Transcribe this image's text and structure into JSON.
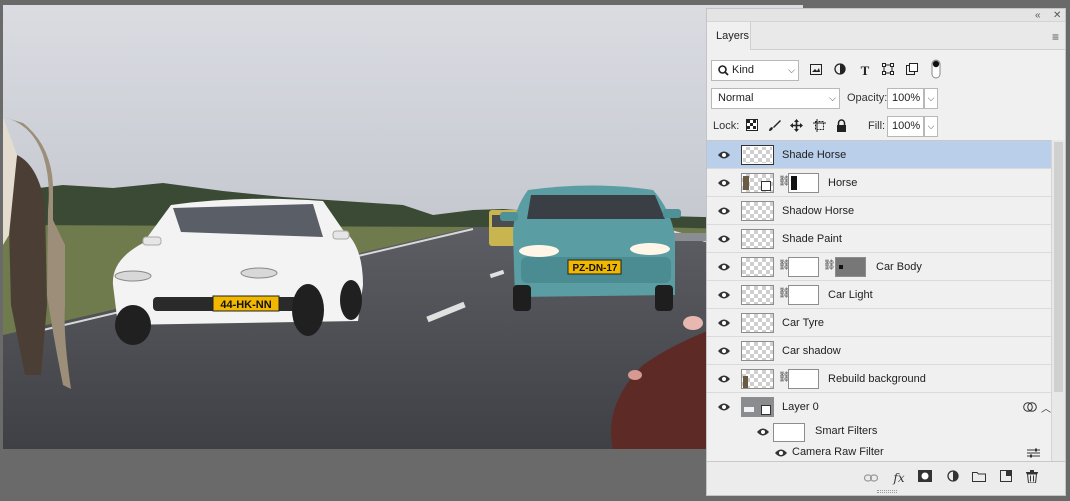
{
  "photo": {
    "car_left_plate": "44-HK-NN",
    "car_right_plate": "PZ-DN-17"
  },
  "panel": {
    "tab": "Layers",
    "filter": {
      "kind_label": "Kind"
    },
    "blend_mode": "Normal",
    "opacity_label": "Opacity:",
    "opacity_value": "100%",
    "lock_label": "Lock:",
    "fill_label": "Fill:",
    "fill_value": "100%"
  },
  "layers": [
    {
      "name": "Shade Horse",
      "selected": true,
      "mask": false
    },
    {
      "name": "Horse",
      "selected": false,
      "mask": true
    },
    {
      "name": "Shadow Horse",
      "selected": false,
      "mask": false
    },
    {
      "name": "Shade Paint",
      "selected": false,
      "mask": false
    },
    {
      "name": "Car Body",
      "selected": false,
      "mask": true
    },
    {
      "name": "Car Light",
      "selected": false,
      "mask": true
    },
    {
      "name": "Car Tyre",
      "selected": false,
      "mask": false
    },
    {
      "name": "Car shadow",
      "selected": false,
      "mask": false
    },
    {
      "name": "Rebuild background",
      "selected": false,
      "mask": true
    },
    {
      "name": "Layer 0",
      "selected": false,
      "mask": false
    }
  ],
  "smart_filters": {
    "label": "Smart Filters",
    "filter_name": "Camera Raw Filter"
  },
  "colors": {
    "selection": "#b9cfea",
    "panel_bg": "#f0f0f0"
  }
}
